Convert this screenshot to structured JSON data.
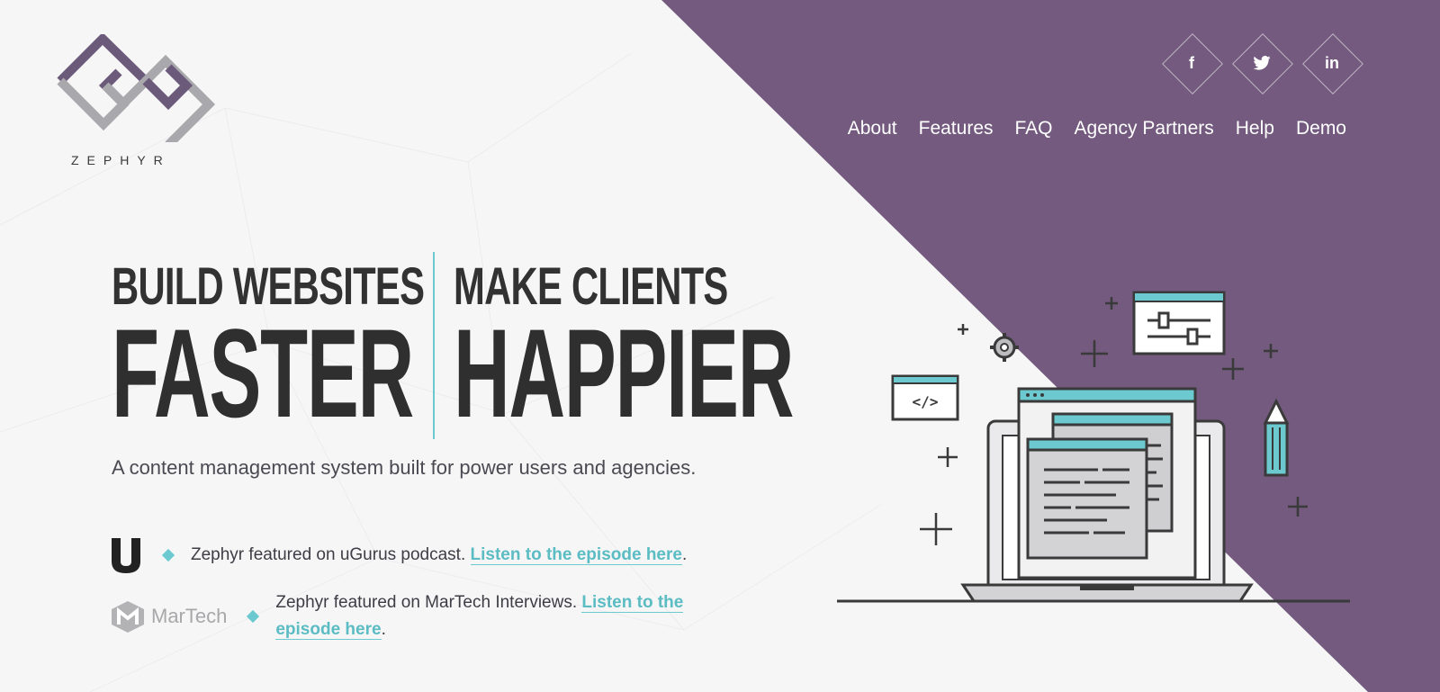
{
  "brand": {
    "name": "ZEPHYR"
  },
  "social": [
    {
      "name": "facebook",
      "glyph": "f"
    },
    {
      "name": "twitter",
      "glyph": "t"
    },
    {
      "name": "linkedin",
      "glyph": "in"
    }
  ],
  "nav": {
    "items": [
      "About",
      "Features",
      "FAQ",
      "Agency Partners",
      "Help",
      "Demo"
    ]
  },
  "hero": {
    "left_small": "BUILD WEBSITES",
    "left_big": "FASTER",
    "right_small": "MAKE CLIENTS",
    "right_big": "HAPPIER",
    "tagline": "A content management system built for power users and agencies."
  },
  "press": [
    {
      "logo": "U",
      "text": "Zephyr featured on uGurus podcast. ",
      "link": "Listen to the episode here",
      "suffix": "."
    },
    {
      "logo": "MarTech",
      "text_line1": "Zephyr featured on MarTech Interviews. ",
      "link_line1": "Listen to the",
      "link_line2": "episode here",
      "suffix": "."
    }
  ],
  "colors": {
    "purple": "#735a7e",
    "teal": "#6cc9cf",
    "dark": "#2f2f2f"
  }
}
